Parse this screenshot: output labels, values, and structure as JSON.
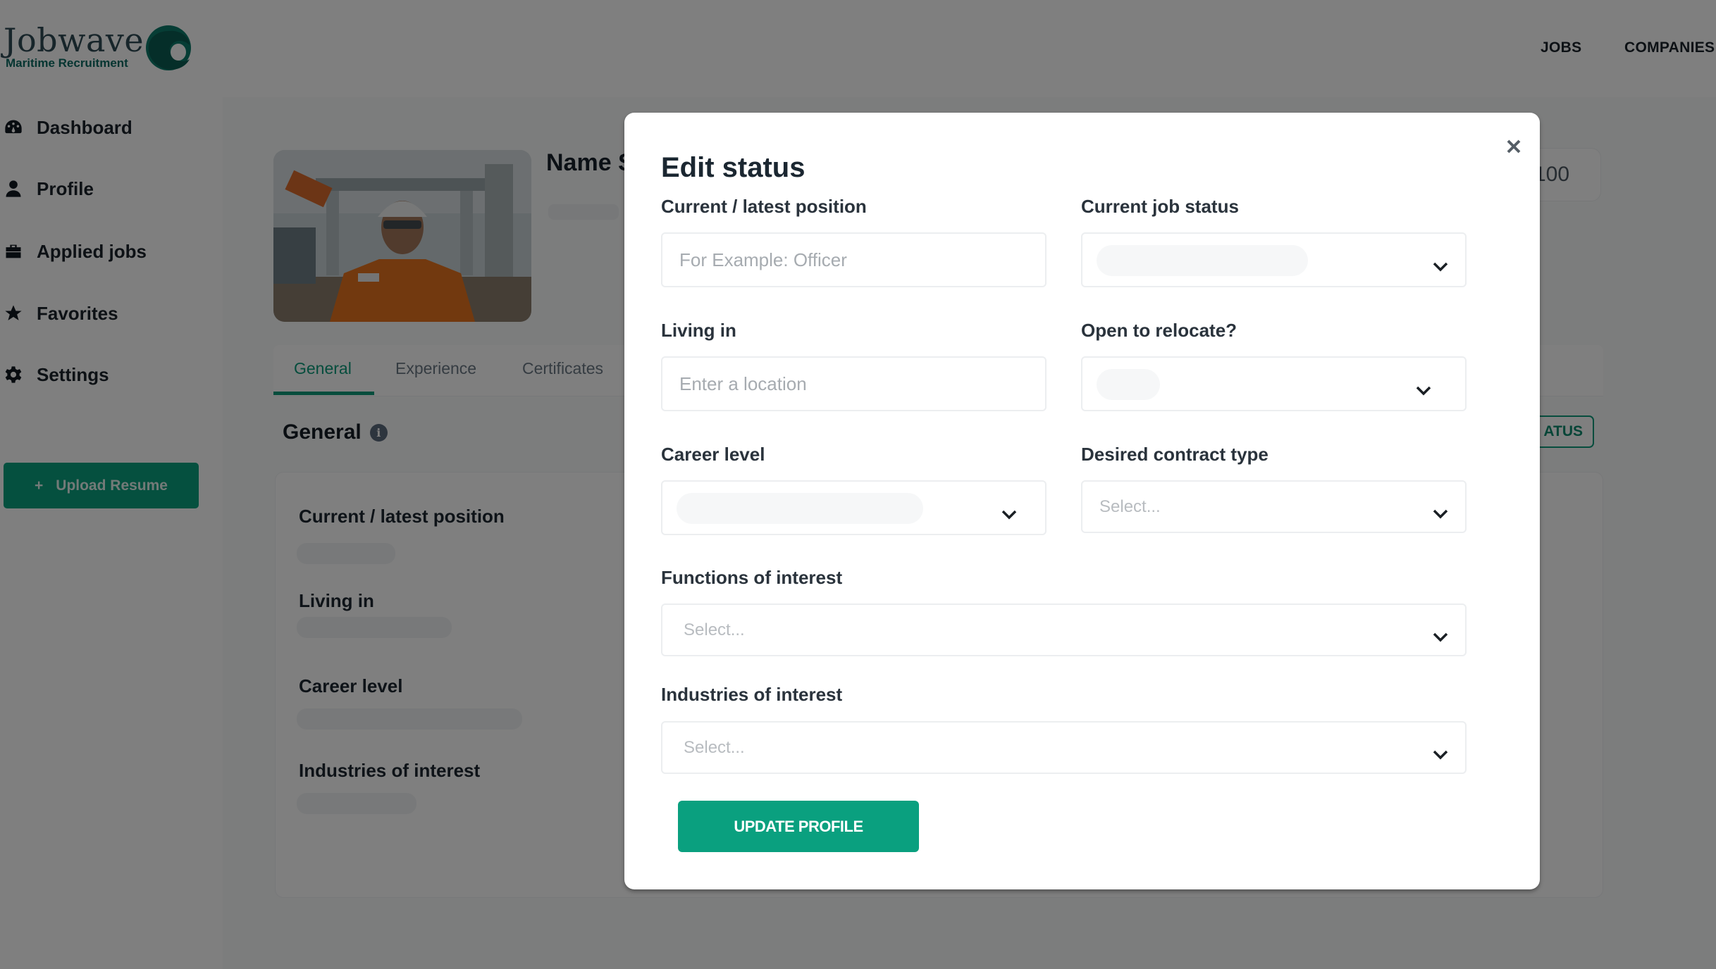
{
  "header": {
    "logo_word": "Jobwave",
    "logo_sub": "Maritime Recruitment",
    "nav": [
      {
        "label": "JOBS"
      },
      {
        "label": "COMPANIES"
      }
    ]
  },
  "sidebar": {
    "items": [
      {
        "label": "Dashboard",
        "icon": "dashboard-icon"
      },
      {
        "label": "Profile",
        "icon": "user-icon"
      },
      {
        "label": "Applied jobs",
        "icon": "briefcase-icon"
      },
      {
        "label": "Favorites",
        "icon": "star-icon"
      },
      {
        "label": "Settings",
        "icon": "gear-icon"
      }
    ],
    "upload_button": {
      "icon": "+",
      "label": "Upload Resume"
    }
  },
  "profile": {
    "name_visible": "Name S",
    "score_text": "/100",
    "tabs": [
      {
        "label": "General",
        "active": true
      },
      {
        "label": "Experience",
        "active": false
      },
      {
        "label": "Certificates",
        "active": false
      }
    ],
    "section_title": "General",
    "status_button_visible": "ATUS",
    "fields": [
      {
        "label": "Current / latest position"
      },
      {
        "label": "Living in"
      },
      {
        "label": "Career level"
      },
      {
        "label": "Industries of interest"
      }
    ]
  },
  "modal": {
    "title": "Edit status",
    "close_label": "×",
    "fields": {
      "current_position": {
        "label": "Current / latest position",
        "placeholder": "For Example: Officer",
        "value": ""
      },
      "job_status": {
        "label": "Current job status",
        "value": "(blurred)"
      },
      "living_in": {
        "label": "Living in",
        "placeholder": "Enter a location",
        "value": ""
      },
      "relocate": {
        "label": "Open to relocate?",
        "value": "(blurred)"
      },
      "career_level": {
        "label": "Career level",
        "value": "(blurred)"
      },
      "contract_type": {
        "label": "Desired contract type",
        "placeholder": "Select..."
      },
      "functions": {
        "label": "Functions of interest",
        "placeholder": "Select..."
      },
      "industries": {
        "label": "Industries of interest",
        "placeholder": "Select..."
      }
    },
    "submit_label": "UPDATE PROFILE"
  },
  "colors": {
    "brand": "#0aa07f",
    "brand_dark": "#0b6b63",
    "overlay": "rgba(0,0,0,0.5)"
  }
}
